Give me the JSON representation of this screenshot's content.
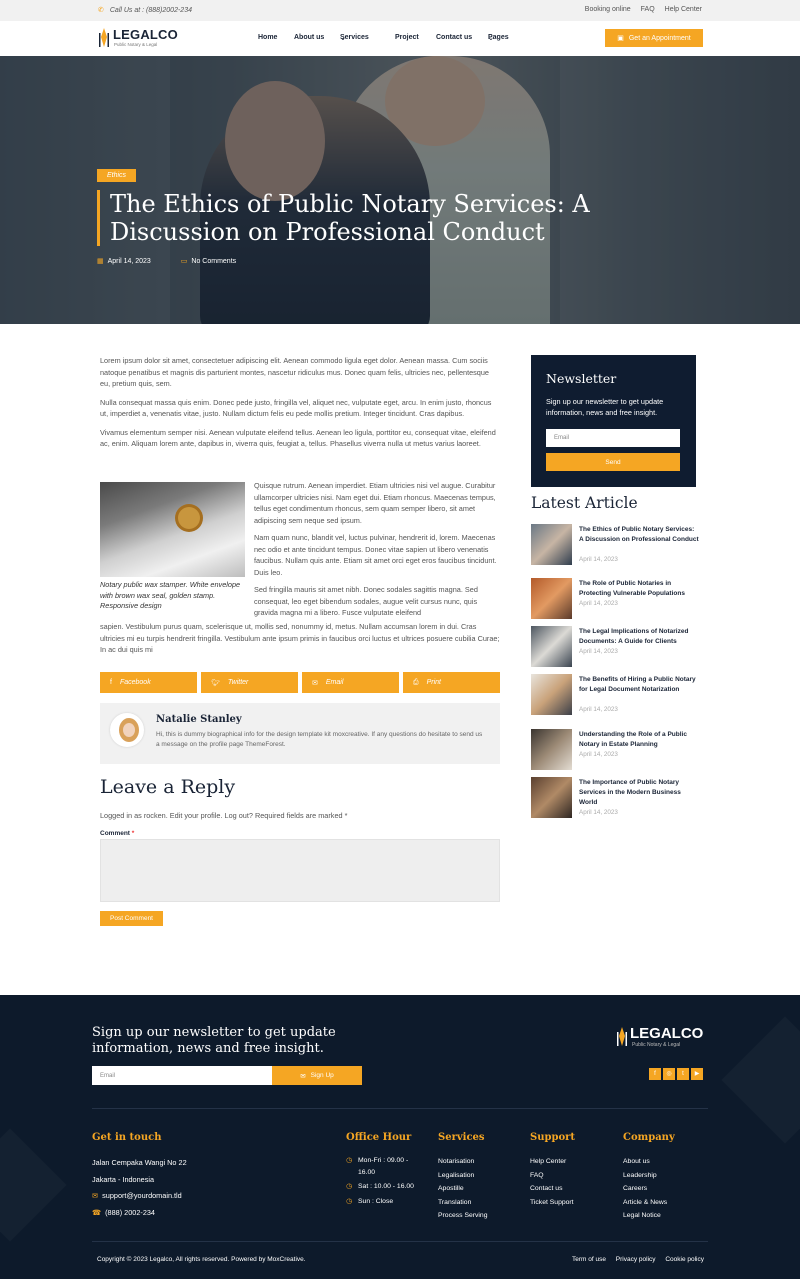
{
  "topbar": {
    "call": "Call Us at : (888)2002-234",
    "links": [
      "Booking online",
      "FAQ",
      "Help Center"
    ]
  },
  "nav": {
    "logo": {
      "name": "LEGALCO",
      "tagline": "Public Notary & Legal"
    },
    "menu": [
      "Home",
      "About us",
      "Services",
      "Project",
      "Contact us",
      "Pages"
    ],
    "cta": "Get an Appointment"
  },
  "hero": {
    "category": "Ethics",
    "title": "The Ethics of Public Notary Services: A Discussion on Professional Conduct",
    "date": "April 14, 2023",
    "comments": "No Comments"
  },
  "article": {
    "p1": "Lorem ipsum dolor sit amet, consectetuer adipiscing elit. Aenean commodo ligula eget dolor. Aenean massa. Cum sociis natoque penatibus et magnis dis parturient montes, nascetur ridiculus mus. Donec quam felis, ultricies nec, pellentesque eu, pretium quis, sem.",
    "p2": "Nulla consequat massa quis enim. Donec pede justo, fringilla vel, aliquet nec, vulputate eget, arcu. In enim justo, rhoncus ut, imperdiet a, venenatis vitae, justo. Nullam dictum felis eu pede mollis pretium. Integer tincidunt. Cras dapibus.",
    "p3": "Vivamus elementum semper nisi. Aenean vulputate eleifend tellus. Aenean leo ligula, porttitor eu, consequat vitae, eleifend ac, enim. Aliquam lorem ante, dapibus in, viverra quis, feugiat a, tellus. Phasellus viverra nulla ut metus varius laoreet.",
    "caption": "Notary public wax stamper. White envelope with brown wax seal, golden stamp. Responsive design",
    "p4": "Quisque rutrum. Aenean imperdiet. Etiam ultricies nisi vel augue. Curabitur ullamcorper ultricies nisi. Nam eget dui. Etiam rhoncus. Maecenas tempus, tellus eget condimentum rhoncus, sem quam semper libero, sit amet adipiscing sem neque sed ipsum.",
    "p5": "Nam quam nunc, blandit vel, luctus pulvinar, hendrerit id, lorem. Maecenas nec odio et ante tincidunt tempus. Donec vitae sapien ut libero venenatis faucibus. Nullam quis ante. Etiam sit amet orci eget eros faucibus tincidunt. Duis leo.",
    "p6a": "Sed fringilla mauris sit amet nibh. Donec sodales sagittis magna. Sed consequat, leo eget bibendum sodales, augue velit cursus nunc, quis gravida magna mi a libero. Fusce vulputate eleifend",
    "p6b": "sapien. Vestibulum purus quam, scelerisque ut, mollis sed, nonummy id, metus. Nullam accumsan lorem in dui. Cras ultricies mi eu turpis hendrerit fringilla. Vestibulum ante ipsum primis in faucibus orci luctus et ultrices posuere cubilia Curae; In ac dui quis mi"
  },
  "share": [
    "Facebook",
    "Twitter",
    "Email",
    "Print"
  ],
  "author": {
    "name": "Natalie Stanley",
    "bio": "Hi, this is dummy biographical info for the design template kit moxcreative. If any questions do hesitate to send us a message on the profile page ThemeForest."
  },
  "reply": {
    "heading": "Leave a Reply",
    "logged": "Logged in as rocken. Edit your profile. Log out? Required fields are marked *",
    "comment_label": "Comment",
    "submit": "Post Comment"
  },
  "sidebar": {
    "newsletter": {
      "title": "Newsletter",
      "text": "Sign up our newsletter to get update information, news and free insight.",
      "placeholder": "Email",
      "button": "Send"
    },
    "latest_title": "Latest Article",
    "articles": [
      {
        "title": "The Ethics of Public Notary Services: A Discussion on Professional Conduct",
        "date": "April 14, 2023"
      },
      {
        "title": "The Role of Public Notaries in Protecting Vulnerable Populations",
        "date": "April 14, 2023"
      },
      {
        "title": "The Legal Implications of Notarized Documents: A Guide for Clients",
        "date": "April 14, 2023"
      },
      {
        "title": "The Benefits of Hiring a Public Notary for Legal Document Notarization",
        "date": "April 14, 2023"
      },
      {
        "title": "Understanding the Role of a Public Notary in Estate Planning",
        "date": "April 14, 2023"
      },
      {
        "title": "The Importance of Public Notary Services in the Modern Business World",
        "date": "April 14, 2023"
      }
    ]
  },
  "footer": {
    "newsletter": "Sign up our newsletter to get update information, news and free insight.",
    "email_placeholder": "Email",
    "signup": "Sign Up",
    "logo": {
      "name": "LEGALCO",
      "tagline": "Public Notary & Legal"
    },
    "get_in_touch": {
      "title": "Get in touch",
      "address1": "Jalan Cempaka Wangi No 22",
      "address2": "Jakarta - Indonesia",
      "email": "support@yourdomain.tld",
      "phone": "(888) 2002-234"
    },
    "office": {
      "title": "Office Hour",
      "rows": [
        "Mon-Fri : 09.00 - 16.00",
        "Sat : 10.00 - 16.00",
        "Sun : Close"
      ]
    },
    "services": {
      "title": "Services",
      "items": [
        "Notarisation",
        "Legalisation",
        "Apostille",
        "Translation",
        "Process Serving"
      ]
    },
    "support": {
      "title": "Support",
      "items": [
        "Help Center",
        "FAQ",
        "Contact us",
        "Ticket Support"
      ]
    },
    "company": {
      "title": "Company",
      "items": [
        "About us",
        "Leadership",
        "Careers",
        "Article & News",
        "Legal Notice"
      ]
    },
    "copyright": "Copyright © 2023 Legalco, All rights reserved. Powered by MoxCreative.",
    "legal": [
      "Term of use",
      "Privacy policy",
      "Cookie policy"
    ]
  },
  "colors": {
    "accent": "#f5a623",
    "navy": "#0d1a2b"
  }
}
